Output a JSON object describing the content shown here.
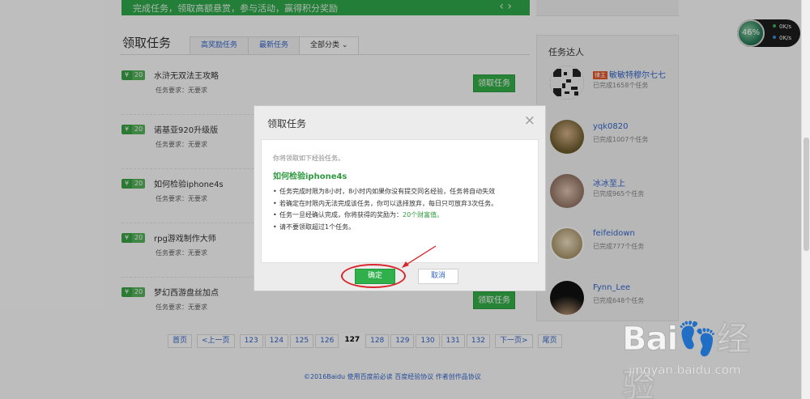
{
  "banner": {
    "text": "完成任务，领取高额悬赏，参与活动，赢得积分奖励",
    "arrows": "‹ ›"
  },
  "section": {
    "title": "领取任务",
    "tabs": [
      "高奖励任务",
      "最新任务",
      "全部分类 ⌄"
    ]
  },
  "tasks": [
    {
      "badge": "20",
      "title": "水浒无双法王攻略",
      "req": "任务要求：无要求",
      "button": "领取任务"
    },
    {
      "badge": "20",
      "title": "诺基亚920升级版",
      "req": "任务要求：无要求",
      "button": ""
    },
    {
      "badge": "20",
      "title": "如何检验iphone4s",
      "req": "任务要求：无要求",
      "button": ""
    },
    {
      "badge": "20",
      "title": "rpg游戏制作大师",
      "req": "任务要求：无要求",
      "button": ""
    },
    {
      "badge": "20",
      "title": "梦幻西游盘丝加点",
      "req": "任务要求：无要求",
      "button": "领取任务"
    }
  ],
  "pagination": {
    "first": "首页",
    "prev": "<上一页",
    "pages": [
      "123",
      "124",
      "125",
      "126",
      "127",
      "128",
      "129",
      "130",
      "131",
      "132"
    ],
    "current": "127",
    "next": "下一页>",
    "last": "尾页"
  },
  "footer": {
    "text": "©2016Baidu  使用百度前必读  百度经验协议  作者创作品协议"
  },
  "sidebar": {
    "title": "任务达人",
    "users": [
      {
        "role": "律主",
        "name": "敏敏特穆尔七七",
        "done": "已完成1658个任务",
        "avatar_color": "#2a2a2a"
      },
      {
        "role": "",
        "name": "yqk0820",
        "done": "已完成1007个任务",
        "avatar_color": "#8a7a3c"
      },
      {
        "role": "",
        "name": "冰冰至上",
        "done": "已完成965个任务",
        "avatar_color": "#b59a8a"
      },
      {
        "role": "",
        "name": "feifeidown",
        "done": "已完成777个任务",
        "avatar_color": "#c9bfa4"
      },
      {
        "role": "",
        "name": "Fynn_Lee",
        "done": "已完成648个任务",
        "avatar_color": "#111111"
      }
    ]
  },
  "widget": {
    "percent": "46%",
    "up": "0K/s",
    "down": "0K/s"
  },
  "modal": {
    "title": "领取任务",
    "close": "×",
    "intro": "你将领取如下经验任务。",
    "task_name": "如何检验iphone4s",
    "rules": [
      "任务完成时限为8小时，8小时内如果你没有提交同名经验，任务将自动失效",
      "若确定在时限内无法完成该任务，你可以选择放弃，每日只可放弃3次任务。",
      "任务一旦经确认完成，你将获得的奖励为：",
      "请不要领取超过1个任务。"
    ],
    "reward": "20个财富值。",
    "ok": "确定",
    "cancel": "取消"
  },
  "watermark": {
    "logo": "Bai👣经验",
    "url": "jingyan.baidu.com"
  },
  "colors": {
    "accent": "#2fb04a",
    "link": "#3366cc",
    "annotation": "#d9262c"
  }
}
